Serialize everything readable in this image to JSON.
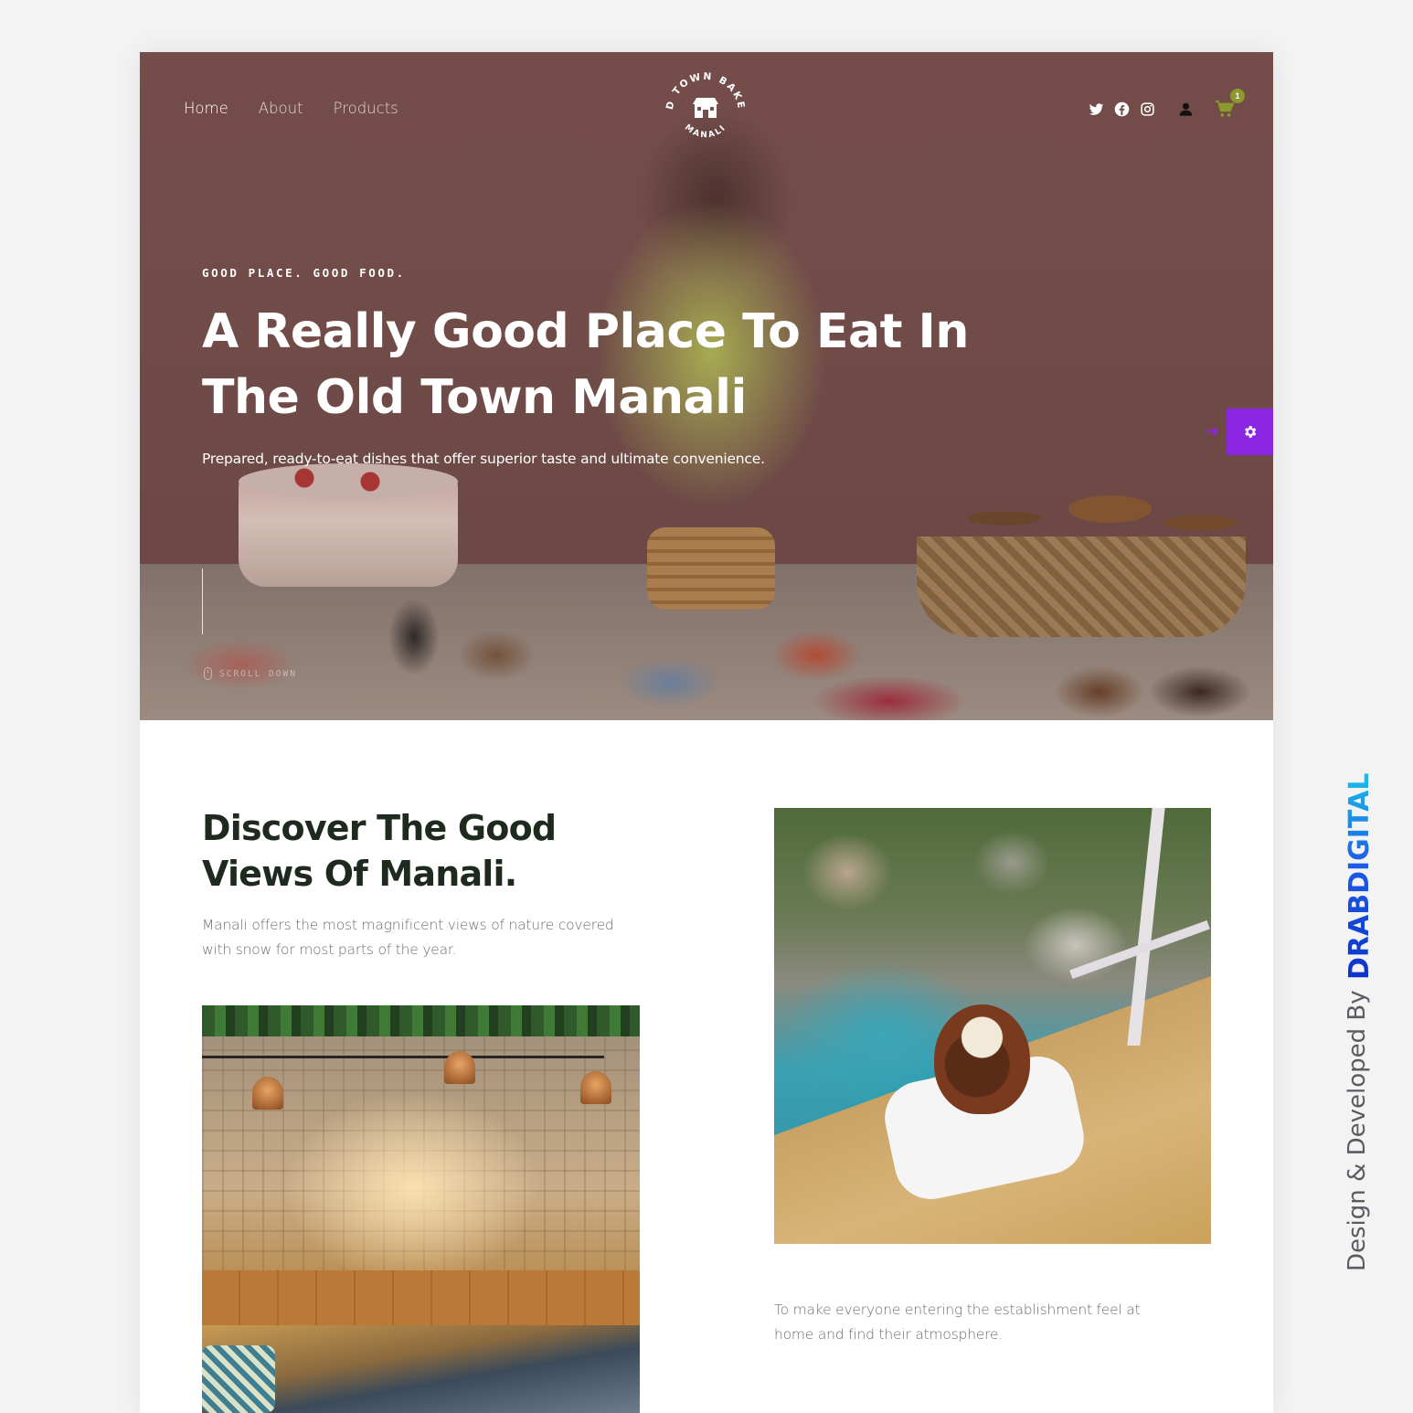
{
  "nav": {
    "items": [
      {
        "label": "Home",
        "active": true
      },
      {
        "label": "About",
        "active": false
      },
      {
        "label": "Products",
        "active": false
      }
    ]
  },
  "logo": {
    "top_text": "OLD TOWN BAKERY",
    "bottom_text": "MANALI"
  },
  "header_icons": [
    "twitter-icon",
    "facebook-icon",
    "instagram-icon",
    "user-icon",
    "cart-icon"
  ],
  "cart": {
    "count": "1"
  },
  "hero": {
    "eyebrow": "GOOD PLACE. GOOD FOOD.",
    "title": "A Really Good Place To Eat In The Old Town Manali",
    "subtitle": "Prepared, ready-to-eat dishes that offer superior taste and ultimate convenience.",
    "scroll_label": "SCROLL DOWN"
  },
  "about": {
    "title": "Discover The Good Views Of Manali.",
    "text": "Manali offers the most magnificent views of nature covered with snow for most parts of the year.",
    "text2": "To make everyone entering the establishment feel at home and find their atmosphere."
  },
  "credit": {
    "prefix": "Design & Developed By",
    "brand": "DRABDIGITAL"
  },
  "colors": {
    "hero_overlay": "#74504c",
    "accent_purple": "#8a26e0",
    "cart_badge": "#8b9a2a",
    "heading_dark": "#1f2a1e",
    "brand_blue": "#0b32c8"
  }
}
